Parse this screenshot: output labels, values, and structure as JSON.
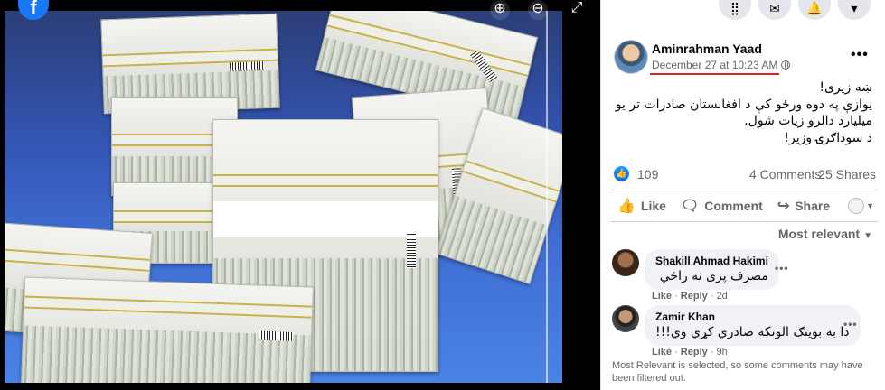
{
  "viewer": {
    "photo_alt": "Bundles of 100 dollar bills wrapped in plastic",
    "icons": [
      "facebook-logo",
      "zoom-in-icon",
      "zoom-out-icon",
      "fullscreen-icon"
    ]
  },
  "header_icons": [
    "menu-grid-icon",
    "messenger-icon",
    "notifications-icon",
    "account-caret-icon"
  ],
  "post": {
    "author": "Aminrahman Yaad",
    "timestamp": "December 27 at 10:23 AM",
    "privacy": "globe-icon",
    "text_lines": [
      "ښه زیری!",
      "یوازې په دوه ورځو کې د افغانستان صادرات تر یو",
      "میلیارد دالرو زیات شول.",
      "د سوداګرۍ وزیر!"
    ],
    "reactions": "109",
    "comments": "4 Comments",
    "shares": "25 Shares"
  },
  "actions": {
    "like": "Like",
    "comment": "Comment",
    "share": "Share"
  },
  "sort_label": "Most relevant",
  "comments": [
    {
      "name": "Shakill Ahmad Hakimi",
      "text": "مصرف پری نه راځي",
      "like": "Like",
      "reply": "Reply",
      "time": "2d"
    },
    {
      "name": "Zamir Khan",
      "text": "دا به بوینګ الوتکه صادري کړي وي!!!",
      "like": "Like",
      "reply": "Reply",
      "time": "9h"
    }
  ],
  "notice": "Most Relevant is selected, so some comments may have been filtered out.",
  "colors": {
    "brand": "#1877f2",
    "underline": "#e0211f",
    "bubble": "#f0f2f5",
    "secondary_text": "#65676b"
  }
}
